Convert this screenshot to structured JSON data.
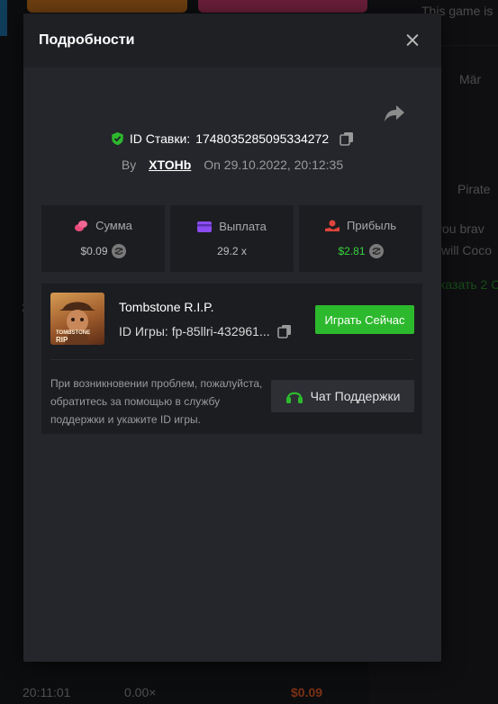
{
  "background": {
    "right_panel": {
      "top_text": "This game is",
      "label_1": "Mär",
      "label_2": "Pirate",
      "line_1": "you brav",
      "line_2": "will Coco",
      "link": "казать 2 С"
    },
    "rows_text": "2",
    "bottom_row": {
      "time": "20:11:01",
      "multiplier": "0.00×",
      "amount": "$0.09"
    }
  },
  "modal": {
    "title": "Подробности",
    "bet_id_label": "ID Ставки:",
    "bet_id": "1748035285095334272",
    "by_label": "By",
    "username": "XTOHb",
    "on_label": "On",
    "date": "29.10.2022, 20:12:35",
    "stats": {
      "amount": {
        "label": "Сумма",
        "value": "$0.09"
      },
      "payout": {
        "label": "Выплата",
        "value": "29.2 x"
      },
      "profit": {
        "label": "Прибыль",
        "value": "$2.81"
      }
    },
    "game": {
      "name": "Tombstone R.I.P.",
      "id_label": "ID Игры:",
      "id_value": "fp-85llri-432961...",
      "thumb_text": "TOMBSTONE RIP",
      "play_label": "Играть Сейчас"
    },
    "help_text": "При возникновении проблем, пожалуйста, обратитесь за помощью в службу поддержки и укажите ID игры.",
    "support_label": "Чат Поддержки"
  },
  "colors": {
    "accent_green": "#2db92d",
    "profit_green": "#35d33c",
    "amount_icon": "#e84a7a",
    "payout_icon": "#8a4cf0",
    "profit_icon": "#e0443a"
  }
}
